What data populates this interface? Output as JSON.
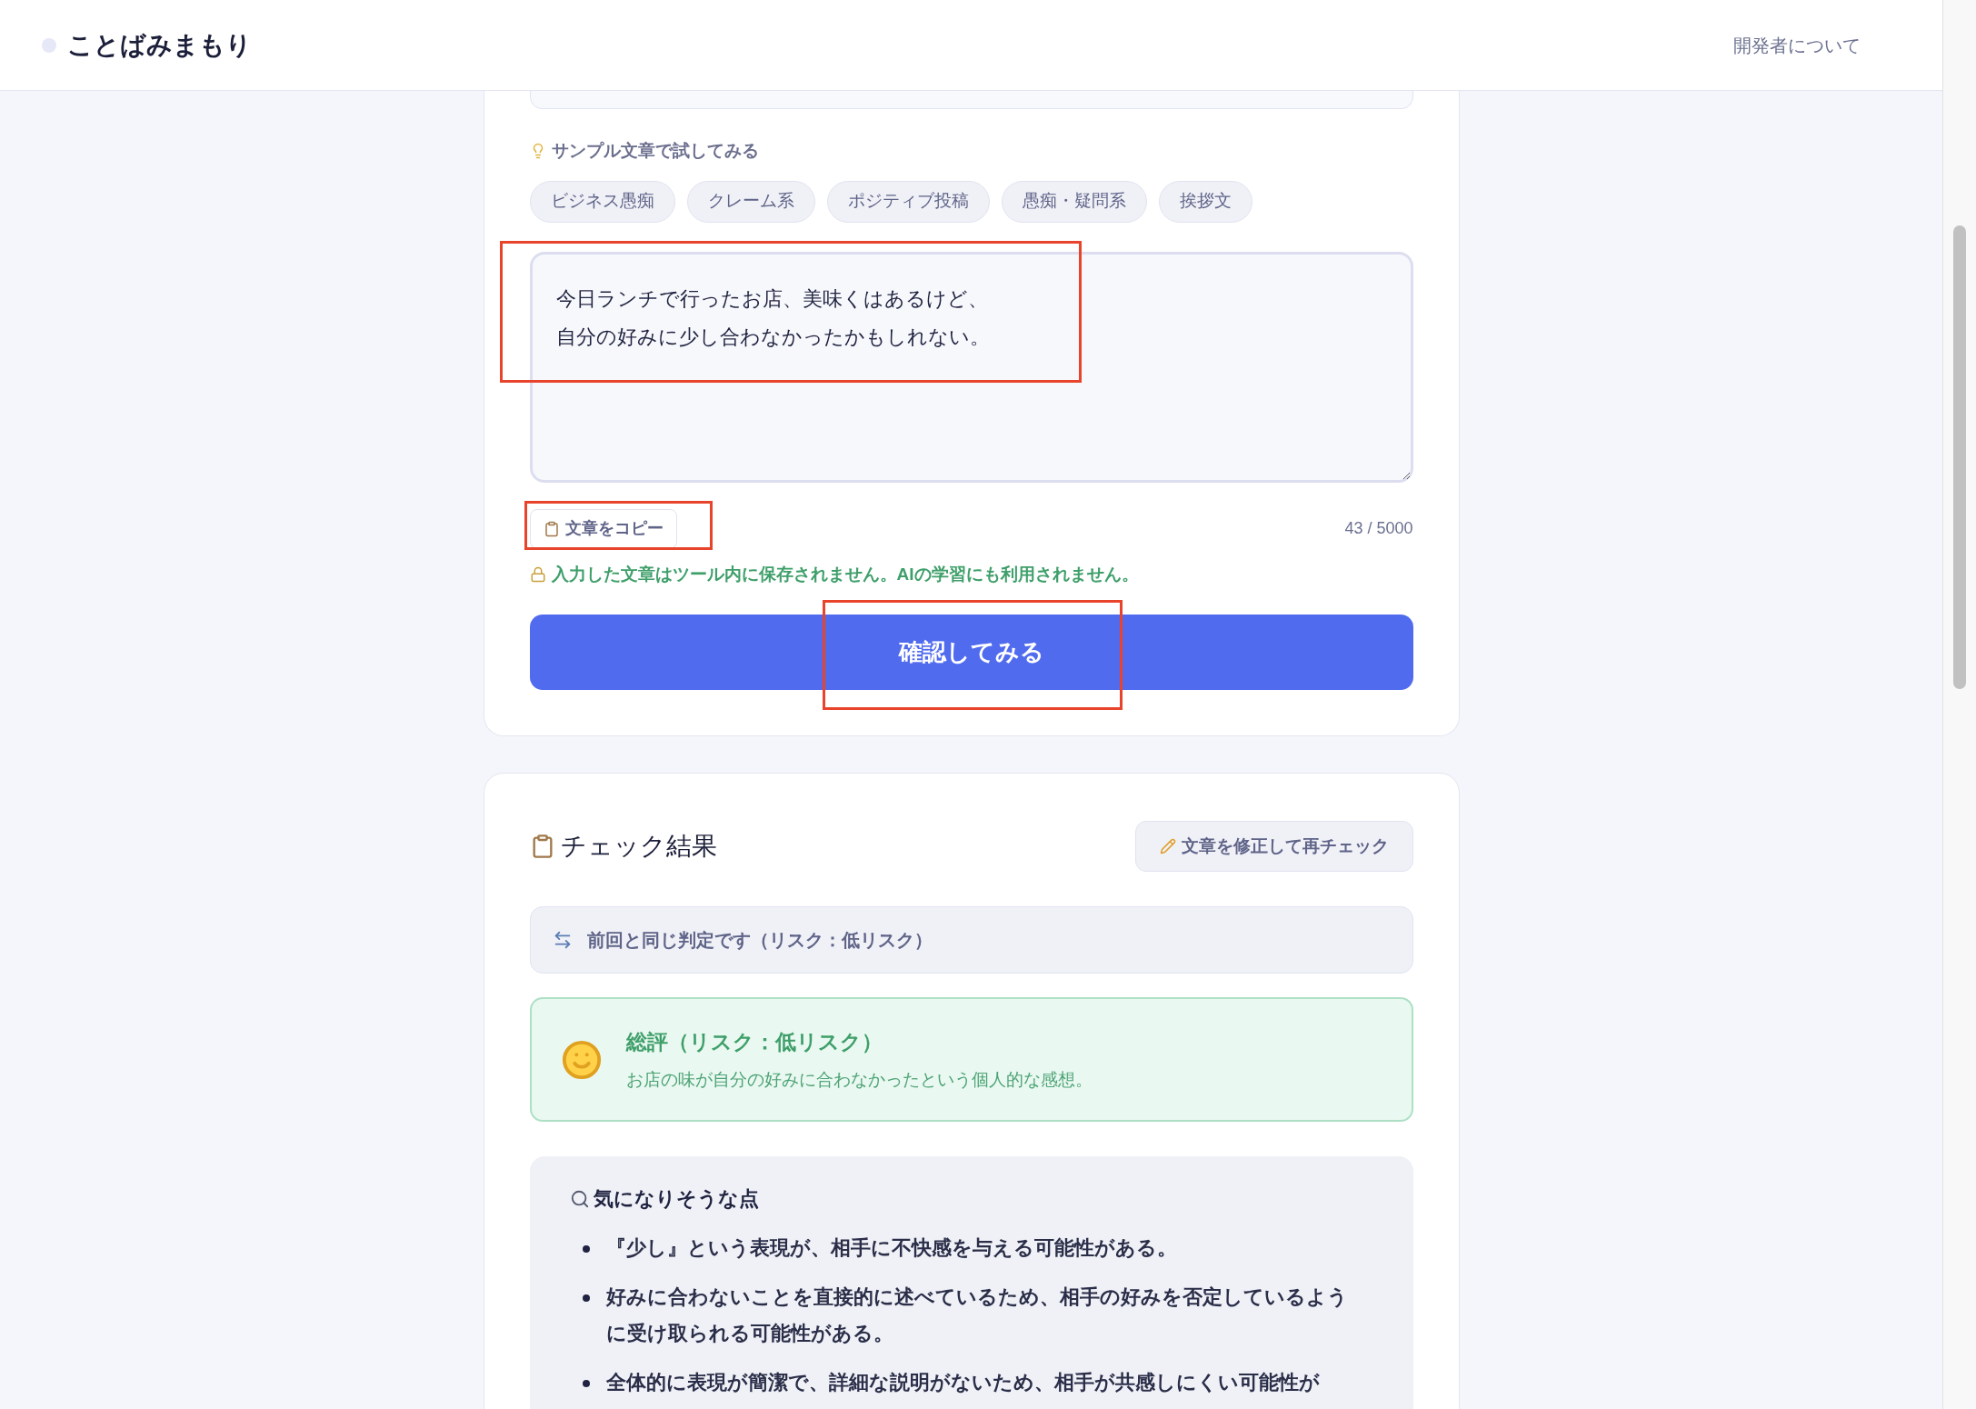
{
  "header": {
    "title": "ことばみまもり",
    "link": "開発者について"
  },
  "input_card": {
    "sample_label": "サンプル文章で試してみる",
    "samples": [
      {
        "label": "ビジネス愚痴"
      },
      {
        "label": "クレーム系"
      },
      {
        "label": "ポジティブ投稿"
      },
      {
        "label": "愚痴・疑問系"
      },
      {
        "label": "挨拶文"
      }
    ],
    "textarea": {
      "lines": [
        "今日ランチで行ったお店、美味くはあるけど、",
        "自分の好みに少し合わなかったかもしれない。"
      ],
      "highlighted": true
    },
    "copy_button": {
      "label": "文章をコピー",
      "highlighted": true
    },
    "counter": "43 / 5000",
    "privacy_note": "入力した文章はツール内に保存されません。AIの学習にも利用されません。",
    "submit_button": {
      "label": "確認してみる",
      "highlighted": true
    }
  },
  "result_card": {
    "title": "チェック結果",
    "recheck_button": "文章を修正して再チェック",
    "comparison": "前回と同じ判定です（リスク：低リスク）",
    "summary": {
      "title": "総評（リスク：低リスク）",
      "text": "お店の味が自分の好みに合わなかったという個人的な感想。"
    },
    "concerns": {
      "title": "気になりそうな点",
      "items": [
        "『少し』という表現が、相手に不快感を与える可能性がある。",
        "好みに合わないことを直接的に述べているため、相手の好みを否定しているように受け取られる可能性がある。",
        "全体的に表現が簡潔で、詳細な説明がないため、相手が共感しにくい可能性が"
      ]
    }
  }
}
